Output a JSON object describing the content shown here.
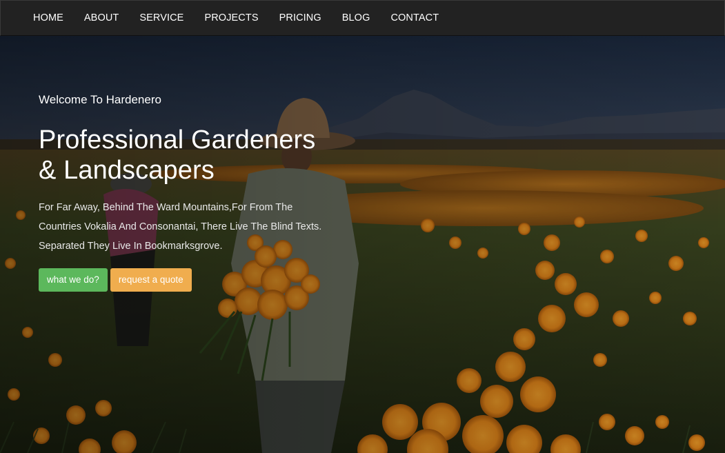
{
  "nav": {
    "items": [
      {
        "label": "HOME"
      },
      {
        "label": "ABOUT"
      },
      {
        "label": "SERVICE"
      },
      {
        "label": "PROJECTS"
      },
      {
        "label": "PRICING"
      },
      {
        "label": "BLOG"
      },
      {
        "label": "CONTACT"
      }
    ]
  },
  "hero": {
    "welcome": "Welcome To Hardenero",
    "headline_line1": "Professional Gardeners",
    "headline_line2": "& Landscapers",
    "lead_line1": "For Far Away, Behind The Ward Mountains,For From The",
    "lead_line2": "Countries Vokalia And Consonantai, There Live The Blind Texts.",
    "lead_line3": "Separated They Live In Bookmarksgrove.",
    "primary_button": "what we do?",
    "secondary_button": "request a quote"
  },
  "colors": {
    "navbar_bg": "#222222",
    "primary_button": "#5cb85c",
    "secondary_button": "#f0ad4e",
    "flower_orange": "#e8891a"
  }
}
